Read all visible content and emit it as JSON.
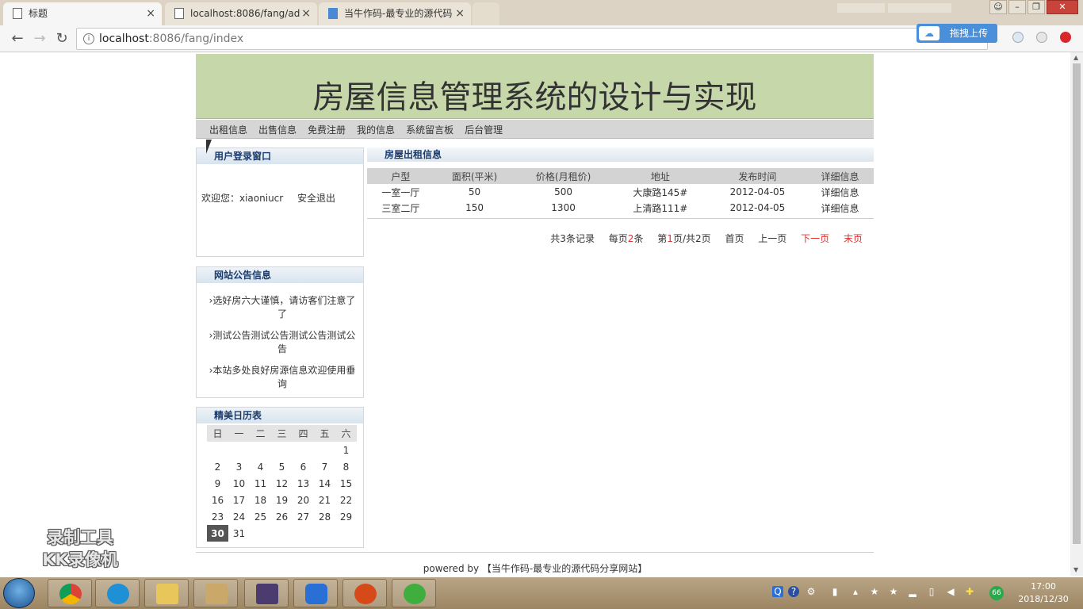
{
  "browser": {
    "tabs": [
      {
        "title": "标题",
        "close": "×"
      },
      {
        "title": "localhost:8086/fang/ad",
        "close": "×"
      },
      {
        "title": "当牛作码-最专业的源代码",
        "close": "×"
      }
    ],
    "url_host": "localhost",
    "url_rest": ":8086/fang/index",
    "upload_label": "拖拽上传",
    "upload_icon": "upload-cloud-icon"
  },
  "site": {
    "title": "房屋信息管理系统的设计与实现",
    "menu": [
      "出租信息",
      "出售信息",
      "免费注册",
      "我的信息",
      "系统留言板",
      "后台管理"
    ]
  },
  "login": {
    "heading": "用户登录窗口",
    "welcome": "欢迎您：xiaoniucr",
    "logout": "安全退出"
  },
  "notice": {
    "heading": "网站公告信息",
    "items": [
      "选好房六大谨慎，请访客们注意了了",
      "测试公告测试公告测试公告测试公告",
      "本站多处良好房源信息欢迎使用垂询"
    ]
  },
  "calendar": {
    "heading": "精美日历表",
    "weekdays": [
      "日",
      "一",
      "二",
      "三",
      "四",
      "五",
      "六"
    ],
    "rows": [
      [
        "",
        "",
        "",
        "",
        "",
        "",
        "1"
      ],
      [
        "2",
        "3",
        "4",
        "5",
        "6",
        "7",
        "8"
      ],
      [
        "9",
        "10",
        "11",
        "12",
        "13",
        "14",
        "15"
      ],
      [
        "16",
        "17",
        "18",
        "19",
        "20",
        "21",
        "22"
      ],
      [
        "23",
        "24",
        "25",
        "26",
        "27",
        "28",
        "29"
      ],
      [
        "30",
        "31",
        "",
        "",
        "",
        "",
        ""
      ]
    ],
    "today": "30"
  },
  "rent": {
    "heading": "房屋出租信息",
    "columns": [
      "户型",
      "面积(平米)",
      "价格(月租价)",
      "地址",
      "发布时间",
      "详细信息"
    ],
    "rows": [
      [
        "一室一厅",
        "50",
        "500",
        "大康路145#",
        "2012-04-05",
        "详细信息"
      ],
      [
        "三室二厅",
        "150",
        "1300",
        "上清路111#",
        "2012-04-05",
        "详细信息"
      ]
    ]
  },
  "pager": {
    "total_pre": "共",
    "total_num": "3",
    "total_post": "条记录",
    "per_pre": "每页",
    "per_num": "2",
    "per_post": "条",
    "page_pre": "第",
    "page_num": "1",
    "page_post": "页/共2页",
    "first": "首页",
    "prev": "上一页",
    "next": "下一页",
    "last": "末页"
  },
  "footer": {
    "powered": "powered by",
    "link": "【当牛作码-最专业的源代码分享网站】"
  },
  "watermark": [
    "录制工具",
    "KK录像机"
  ],
  "taskbar": {
    "time": "17:00",
    "date": "2018/12/30",
    "badge": "66"
  },
  "colors": {
    "banner": "#c6d8a9",
    "pager_red": "#e03030",
    "panel_title": "#1a3b6e"
  }
}
